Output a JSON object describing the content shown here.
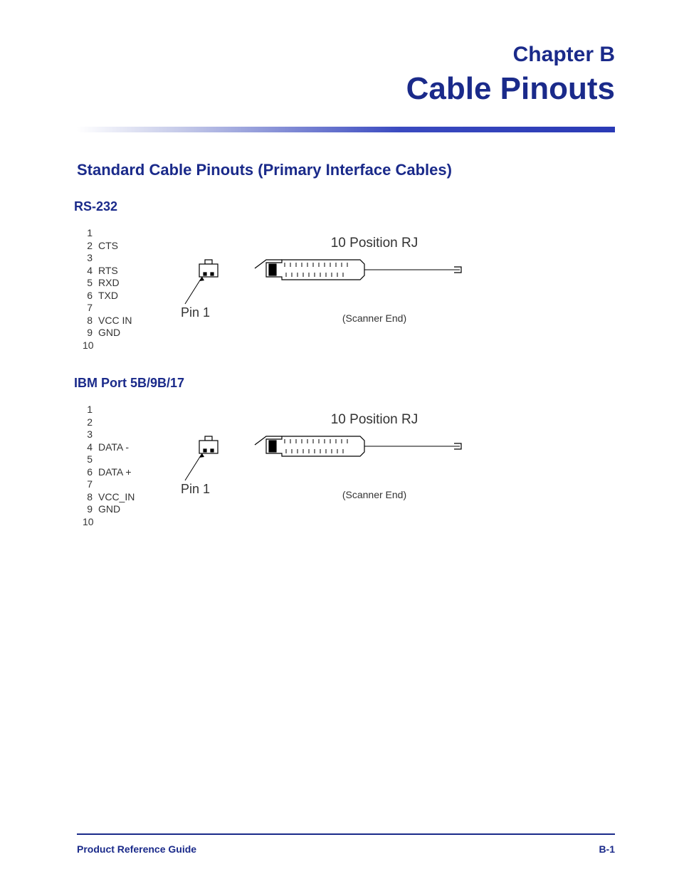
{
  "chapter_label": "Chapter B",
  "title": "Cable Pinouts",
  "section_title": "Standard Cable Pinouts (Primary Interface Cables)",
  "rs232": {
    "heading": "RS-232",
    "pins": [
      {
        "n": "1",
        "sig": ""
      },
      {
        "n": "2",
        "sig": "CTS"
      },
      {
        "n": "3",
        "sig": ""
      },
      {
        "n": "4",
        "sig": "RTS"
      },
      {
        "n": "5",
        "sig": "RXD"
      },
      {
        "n": "6",
        "sig": "TXD"
      },
      {
        "n": "7",
        "sig": ""
      },
      {
        "n": "8",
        "sig": "VCC IN"
      },
      {
        "n": "9",
        "sig": "GND"
      },
      {
        "n": "10",
        "sig": ""
      }
    ],
    "connector_title": "10 Position RJ",
    "pin1_label": "Pin 1",
    "scanner_end": "(Scanner End)"
  },
  "ibm": {
    "heading": "IBM Port 5B/9B/17",
    "pins": [
      {
        "n": "1",
        "sig": ""
      },
      {
        "n": "2",
        "sig": ""
      },
      {
        "n": "3",
        "sig": ""
      },
      {
        "n": "4",
        "sig": "DATA -"
      },
      {
        "n": "5",
        "sig": ""
      },
      {
        "n": "6",
        "sig": "DATA +"
      },
      {
        "n": "7",
        "sig": ""
      },
      {
        "n": "8",
        "sig": "VCC_IN"
      },
      {
        "n": "9",
        "sig": "GND"
      },
      {
        "n": "10",
        "sig": ""
      }
    ],
    "connector_title": "10 Position RJ",
    "pin1_label": "Pin 1",
    "scanner_end": "(Scanner End)"
  },
  "footer": {
    "guide": "Product Reference Guide",
    "page": "B-1"
  }
}
